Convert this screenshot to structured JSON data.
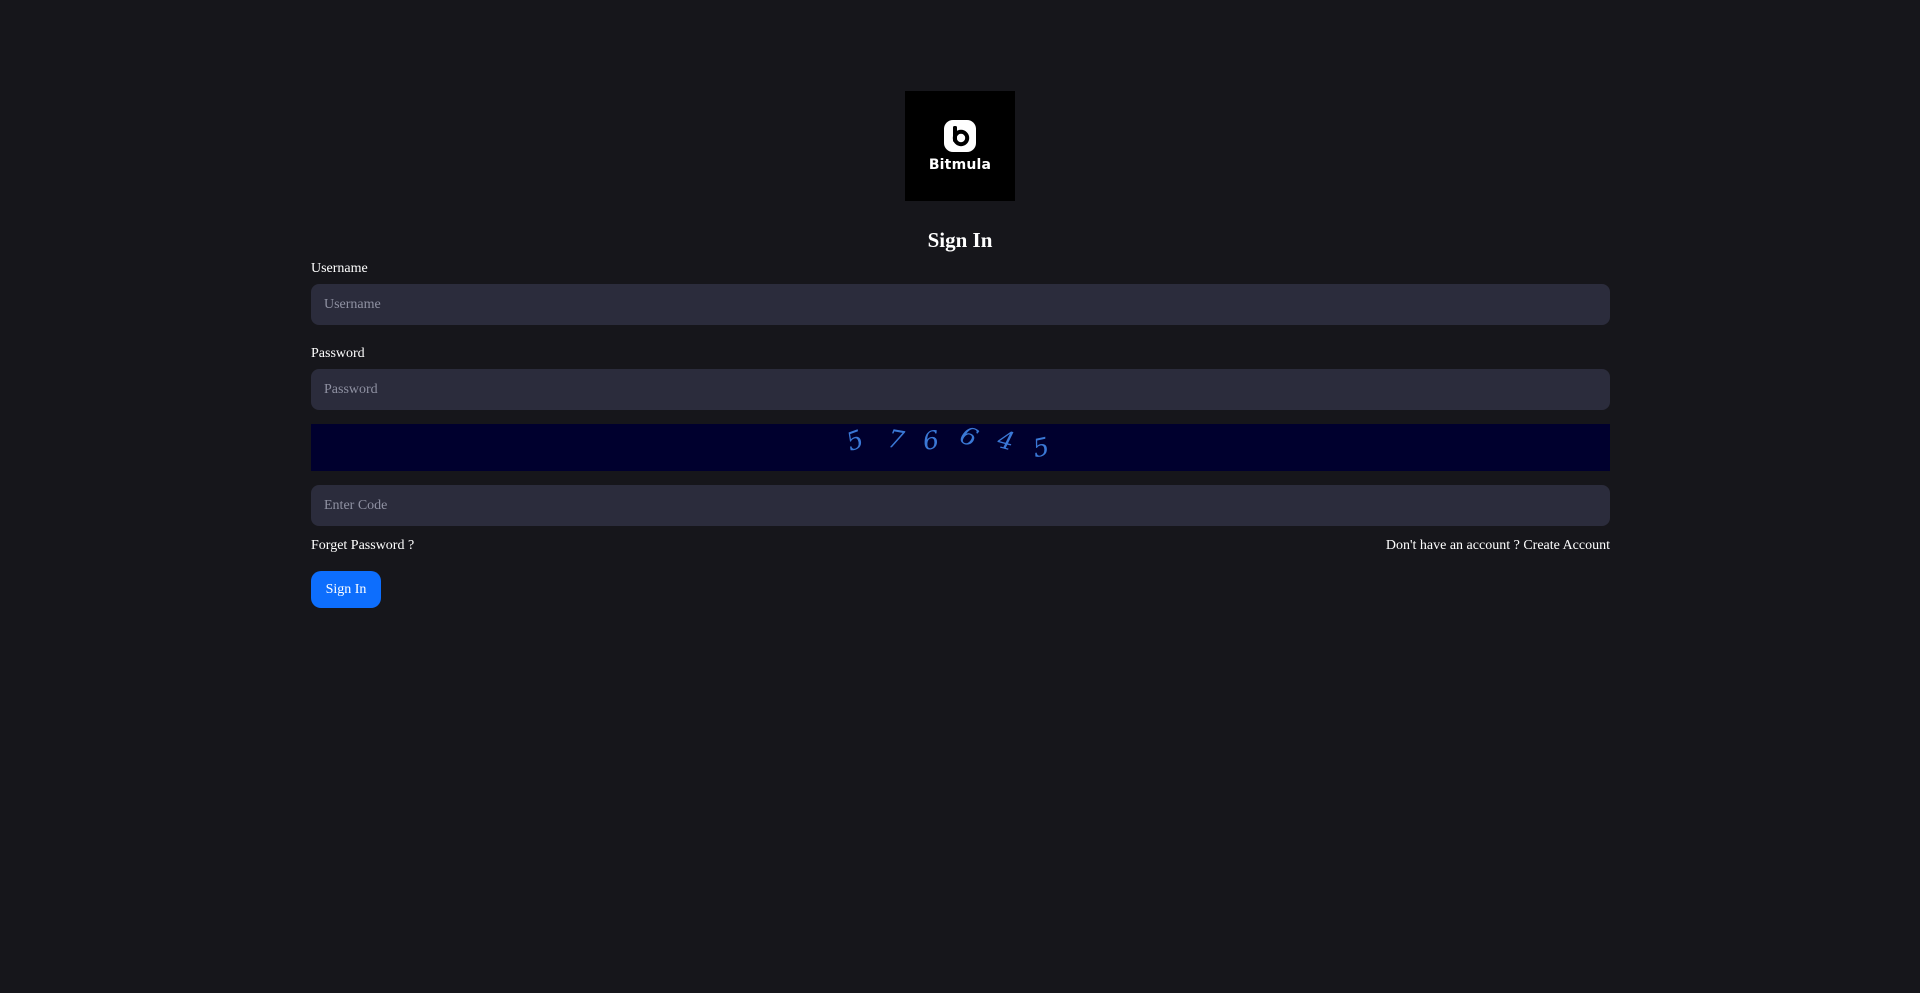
{
  "brand": {
    "name": "Bitmula",
    "logo_icon": "bitmula-b-logo-icon"
  },
  "title": "Sign In",
  "form": {
    "username_label": "Username",
    "username_placeholder": "Username",
    "username_value": "",
    "password_label": "Password",
    "password_placeholder": "Password",
    "password_value": "",
    "captcha_chars": [
      "5",
      "7",
      "6",
      "6",
      "4",
      "5"
    ],
    "code_placeholder": "Enter Code",
    "code_value": ""
  },
  "links": {
    "forgot_password": "Forget Password ?",
    "no_account_prefix": "Don't have an account ?",
    "create_account": "Create Account"
  },
  "submit_label": "Sign In",
  "colors": {
    "background": "#16161b",
    "input_bg": "#2b2c3c",
    "captcha_bg": "#00002e",
    "captcha_text": "#3a78d6",
    "primary": "#0d6efd"
  }
}
